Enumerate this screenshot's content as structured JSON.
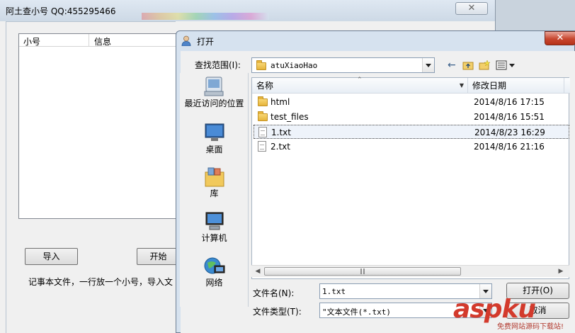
{
  "app": {
    "title": "阿土查小号 QQ:455295466",
    "close_label": "✕",
    "list_headers": [
      "小号",
      "信息"
    ],
    "import_button": "导入",
    "start_button": "开始",
    "hint_text": "记事本文件，一行放一个小号，导入文"
  },
  "dialog": {
    "title": "打开",
    "close_label": "✕",
    "look_in_label": "查找范围(I):",
    "look_in_value": "atuXiaoHao",
    "toolbar_icons": [
      "back-icon",
      "up-folder-icon",
      "new-folder-icon",
      "view-menu-icon"
    ],
    "places": [
      {
        "label": "最近访问的位置",
        "icon": "recent-places-icon"
      },
      {
        "label": "桌面",
        "icon": "desktop-icon"
      },
      {
        "label": "库",
        "icon": "libraries-icon"
      },
      {
        "label": "计算机",
        "icon": "computer-icon"
      },
      {
        "label": "网络",
        "icon": "network-icon"
      }
    ],
    "columns": {
      "name": "名称",
      "date": "修改日期"
    },
    "files": [
      {
        "name": "html",
        "date": "2014/8/16 17:15",
        "type": "folder"
      },
      {
        "name": "test_files",
        "date": "2014/8/16 15:51",
        "type": "folder"
      },
      {
        "name": "1.txt",
        "date": "2014/8/23 16:29",
        "type": "file",
        "selected": true
      },
      {
        "name": "2.txt",
        "date": "2014/8/16 21:16",
        "type": "file"
      }
    ],
    "filename_label": "文件名(N):",
    "filename_value": "1.txt",
    "filetype_label": "文件类型(T):",
    "filetype_value": "\"文本文件(*.txt)",
    "open_button": "打开(O)",
    "cancel_button": "取消"
  },
  "watermark": {
    "brand": "aspku",
    "tagline": "免费网站源码下载站!"
  }
}
